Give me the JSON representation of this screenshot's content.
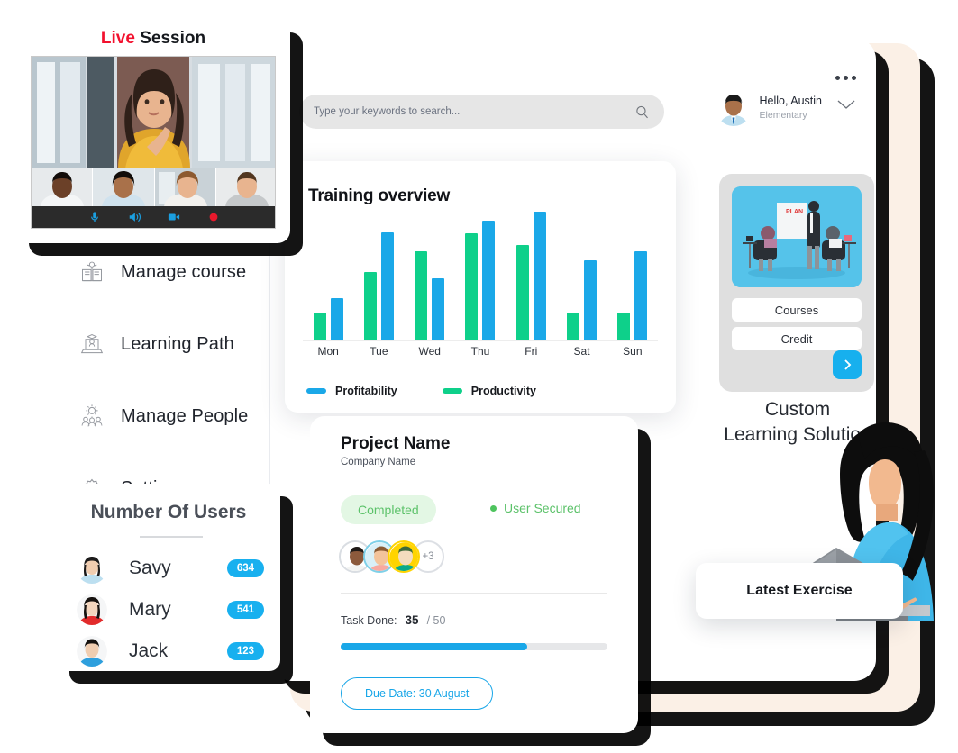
{
  "live_session": {
    "title_highlight": "Live",
    "title_rest": " Session",
    "controls": [
      "microphone-icon",
      "speaker-icon",
      "camera-icon",
      "record-icon"
    ]
  },
  "header": {
    "search": {
      "placeholder": "Type your keywords to search...",
      "value": "",
      "icon": "search-icon"
    },
    "menu_icon": "more-options-icon",
    "chevron_icon": "chevron-down-icon",
    "user": {
      "greeting": "Hello, Austin",
      "role": "Elementary"
    }
  },
  "sidebar": {
    "items": [
      {
        "label": "Manage course",
        "icon": "book-course-icon"
      },
      {
        "label": "Learning Path",
        "icon": "graduation-laptop-icon"
      },
      {
        "label": "Manage People",
        "icon": "people-gear-icon"
      },
      {
        "label": "Setting",
        "icon": "gear-icon"
      }
    ]
  },
  "chart_data": {
    "type": "bar",
    "title": "Training overview",
    "xlabel": "",
    "ylabel": "",
    "ylim": [
      0,
      100
    ],
    "grid": false,
    "legend_position": "bottom-left",
    "categories": [
      "Mon",
      "Tue",
      "Wed",
      "Thu",
      "Fri",
      "Sat",
      "Sun"
    ],
    "series": [
      {
        "name": "Productivity",
        "color": "#0ed08a",
        "values": [
          22,
          53,
          69,
          83,
          74,
          22,
          22
        ]
      },
      {
        "name": "Profitability",
        "color": "#1aa8e8",
        "values": [
          33,
          84,
          48,
          93,
          100,
          62,
          69
        ]
      }
    ]
  },
  "project_card": {
    "title": "Project Name",
    "subtitle": "Company Name",
    "status_badge": "Completed",
    "secure_label": "User Secured",
    "avatars_overflow": "+3",
    "task_label": "Task Done:",
    "task_done": "35",
    "task_total": "/ 50",
    "progress_percent": 70,
    "due_button": "Due Date: 30 August"
  },
  "promo": {
    "buttons": [
      "Courses",
      "Credit"
    ],
    "next_icon": "chevron-right-icon",
    "caption_line1": "Custom",
    "caption_line2": "Learning Solution",
    "latest_exercise": "Latest Exercise"
  },
  "users_card": {
    "title": "Number Of Users",
    "rows": [
      {
        "name": "Savy",
        "count": "634"
      },
      {
        "name": "Mary",
        "count": "541"
      },
      {
        "name": "Jack",
        "count": "123"
      }
    ]
  },
  "colors": {
    "accent_blue": "#18b0ef",
    "accent_green": "#0ed08a",
    "status_green": "#5cc26a",
    "beige_panel": "#fbf0e6",
    "live_red": "#f2112e"
  }
}
